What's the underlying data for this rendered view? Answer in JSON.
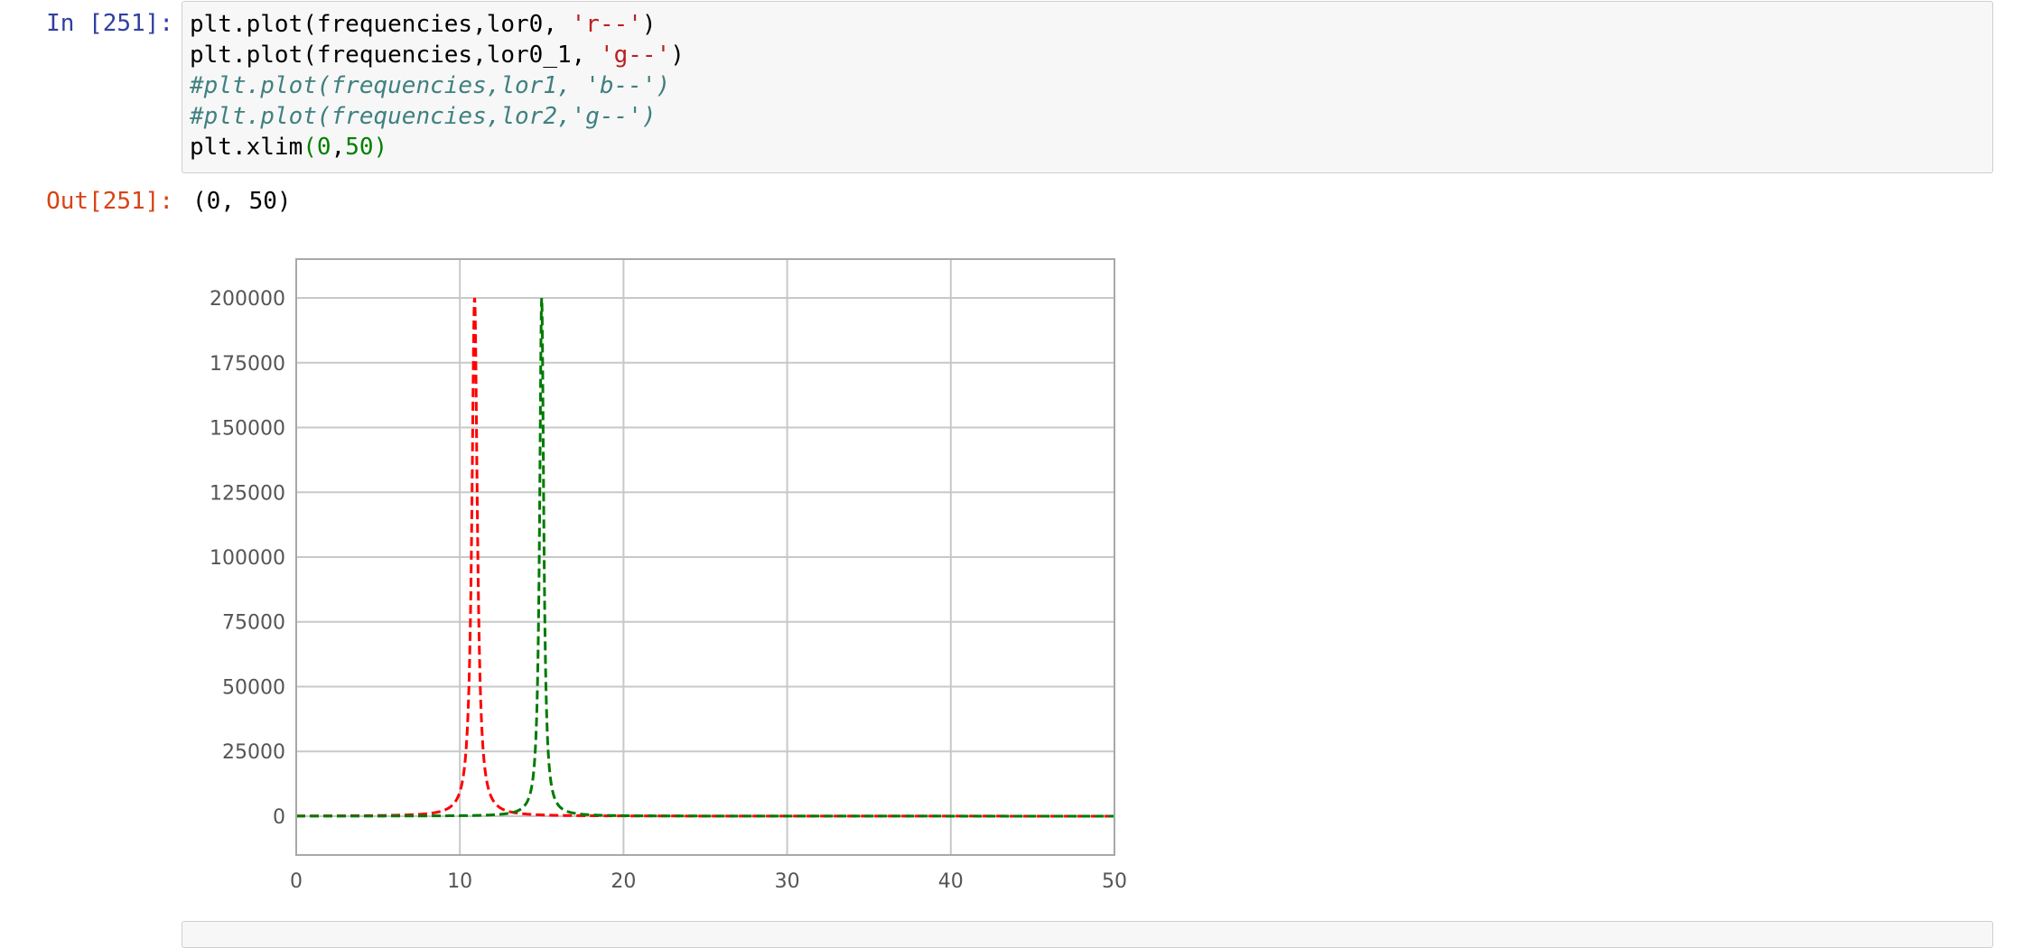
{
  "notebook": {
    "input_prompt": "In [251]:",
    "output_prompt": "Out[251]:",
    "code_lines": [
      [
        {
          "t": "plain",
          "s": "plt.plot(frequencies,lor0, "
        },
        {
          "t": "str",
          "s": "'r--'"
        },
        {
          "t": "plain",
          "s": ")"
        }
      ],
      [
        {
          "t": "plain",
          "s": "plt.plot(frequencies,lor0_1, "
        },
        {
          "t": "str",
          "s": "'g--'"
        },
        {
          "t": "plain",
          "s": ")"
        }
      ],
      [
        {
          "t": "comment",
          "s": "#plt.plot(frequencies,lor1, 'b--')"
        }
      ],
      [
        {
          "t": "comment",
          "s": "#plt.plot(frequencies,lor2,'g--')"
        }
      ],
      [
        {
          "t": "plain",
          "s": "plt.xlim"
        },
        {
          "t": "num",
          "s": "(0"
        },
        {
          "t": "plain",
          "s": ","
        },
        {
          "t": "num",
          "s": "50)"
        }
      ]
    ],
    "output_text": "(0, 50)"
  },
  "colors": {
    "series_red": "#ff0000",
    "series_green": "#007a00",
    "grid": "#c8c8c8",
    "tick_label": "#555555"
  },
  "chart_data": {
    "type": "line",
    "title": "",
    "xlabel": "",
    "ylabel": "",
    "xlim": [
      0,
      50
    ],
    "ylim": [
      -15000,
      215000
    ],
    "xticks": [
      0,
      10,
      20,
      30,
      40,
      50
    ],
    "yticks": [
      0,
      25000,
      50000,
      75000,
      100000,
      125000,
      150000,
      175000,
      200000
    ],
    "grid": true,
    "series": [
      {
        "style": "r--",
        "color": "red",
        "peak_x": 10.9,
        "peak_y": 200000,
        "hwhm": 0.2
      },
      {
        "style": "g--",
        "color": "green",
        "peak_x": 15.0,
        "peak_y": 200000,
        "hwhm": 0.15
      }
    ]
  }
}
